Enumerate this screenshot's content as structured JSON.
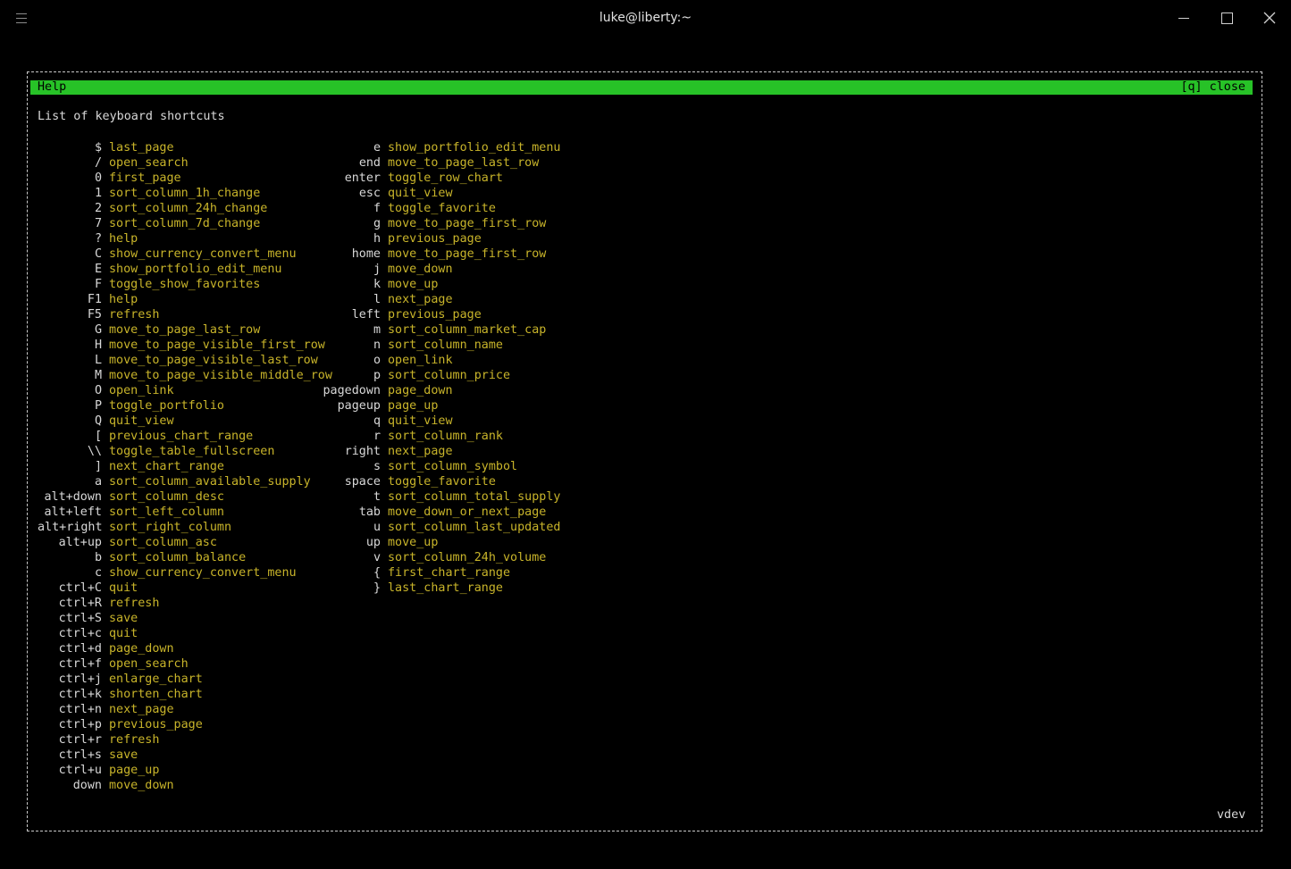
{
  "window": {
    "title": "luke@liberty:~"
  },
  "help": {
    "title": "Help",
    "close_label": "[q] close",
    "subtitle": "List of keyboard shortcuts",
    "footer": "vdev",
    "accent_color": "#27c227",
    "action_color": "#c8b42a",
    "left_column": [
      {
        "key": "$",
        "action": "last_page"
      },
      {
        "key": "/",
        "action": "open_search"
      },
      {
        "key": "0",
        "action": "first_page"
      },
      {
        "key": "1",
        "action": "sort_column_1h_change"
      },
      {
        "key": "2",
        "action": "sort_column_24h_change"
      },
      {
        "key": "7",
        "action": "sort_column_7d_change"
      },
      {
        "key": "?",
        "action": "help"
      },
      {
        "key": "C",
        "action": "show_currency_convert_menu"
      },
      {
        "key": "E",
        "action": "show_portfolio_edit_menu"
      },
      {
        "key": "F",
        "action": "toggle_show_favorites"
      },
      {
        "key": "F1",
        "action": "help"
      },
      {
        "key": "F5",
        "action": "refresh"
      },
      {
        "key": "G",
        "action": "move_to_page_last_row"
      },
      {
        "key": "H",
        "action": "move_to_page_visible_first_row"
      },
      {
        "key": "L",
        "action": "move_to_page_visible_last_row"
      },
      {
        "key": "M",
        "action": "move_to_page_visible_middle_row"
      },
      {
        "key": "O",
        "action": "open_link"
      },
      {
        "key": "P",
        "action": "toggle_portfolio"
      },
      {
        "key": "Q",
        "action": "quit_view"
      },
      {
        "key": "[",
        "action": "previous_chart_range"
      },
      {
        "key": "\\\\",
        "action": "toggle_table_fullscreen"
      },
      {
        "key": "]",
        "action": "next_chart_range"
      },
      {
        "key": "a",
        "action": "sort_column_available_supply"
      },
      {
        "key": "alt+down",
        "action": "sort_column_desc"
      },
      {
        "key": "alt+left",
        "action": "sort_left_column"
      },
      {
        "key": "alt+right",
        "action": "sort_right_column"
      },
      {
        "key": "alt+up",
        "action": "sort_column_asc"
      },
      {
        "key": "b",
        "action": "sort_column_balance"
      },
      {
        "key": "c",
        "action": "show_currency_convert_menu"
      },
      {
        "key": "ctrl+C",
        "action": "quit"
      },
      {
        "key": "ctrl+R",
        "action": "refresh"
      },
      {
        "key": "ctrl+S",
        "action": "save"
      },
      {
        "key": "ctrl+c",
        "action": "quit"
      },
      {
        "key": "ctrl+d",
        "action": "page_down"
      },
      {
        "key": "ctrl+f",
        "action": "open_search"
      },
      {
        "key": "ctrl+j",
        "action": "enlarge_chart"
      },
      {
        "key": "ctrl+k",
        "action": "shorten_chart"
      },
      {
        "key": "ctrl+n",
        "action": "next_page"
      },
      {
        "key": "ctrl+p",
        "action": "previous_page"
      },
      {
        "key": "ctrl+r",
        "action": "refresh"
      },
      {
        "key": "ctrl+s",
        "action": "save"
      },
      {
        "key": "ctrl+u",
        "action": "page_up"
      },
      {
        "key": "down",
        "action": "move_down"
      }
    ],
    "right_column": [
      {
        "key": "e",
        "action": "show_portfolio_edit_menu"
      },
      {
        "key": "end",
        "action": "move_to_page_last_row"
      },
      {
        "key": "enter",
        "action": "toggle_row_chart"
      },
      {
        "key": "esc",
        "action": "quit_view"
      },
      {
        "key": "f",
        "action": "toggle_favorite"
      },
      {
        "key": "g",
        "action": "move_to_page_first_row"
      },
      {
        "key": "h",
        "action": "previous_page"
      },
      {
        "key": "home",
        "action": "move_to_page_first_row"
      },
      {
        "key": "j",
        "action": "move_down"
      },
      {
        "key": "k",
        "action": "move_up"
      },
      {
        "key": "l",
        "action": "next_page"
      },
      {
        "key": "left",
        "action": "previous_page"
      },
      {
        "key": "m",
        "action": "sort_column_market_cap"
      },
      {
        "key": "n",
        "action": "sort_column_name"
      },
      {
        "key": "o",
        "action": "open_link"
      },
      {
        "key": "p",
        "action": "sort_column_price"
      },
      {
        "key": "pagedown",
        "action": "page_down"
      },
      {
        "key": "pageup",
        "action": "page_up"
      },
      {
        "key": "q",
        "action": "quit_view"
      },
      {
        "key": "r",
        "action": "sort_column_rank"
      },
      {
        "key": "right",
        "action": "next_page"
      },
      {
        "key": "s",
        "action": "sort_column_symbol"
      },
      {
        "key": "space",
        "action": "toggle_favorite"
      },
      {
        "key": "t",
        "action": "sort_column_total_supply"
      },
      {
        "key": "tab",
        "action": "move_down_or_next_page"
      },
      {
        "key": "u",
        "action": "sort_column_last_updated"
      },
      {
        "key": "up",
        "action": "move_up"
      },
      {
        "key": "v",
        "action": "sort_column_24h_volume"
      },
      {
        "key": "{",
        "action": "first_chart_range"
      },
      {
        "key": "}",
        "action": "last_chart_range"
      }
    ]
  }
}
